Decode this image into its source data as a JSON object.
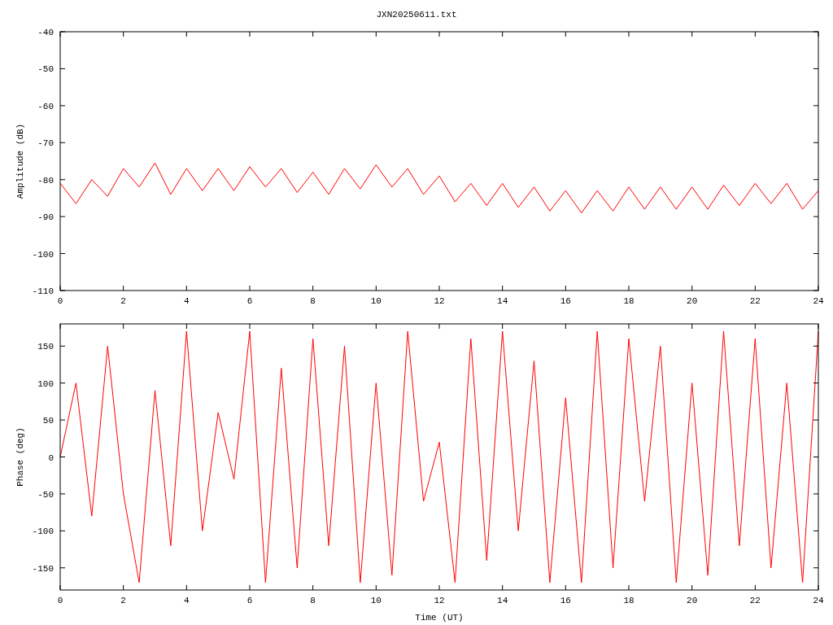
{
  "title": "JXN20250611.txt",
  "amplitude_panel": {
    "chart_data": {
      "type": "line",
      "ylabel": "Amplitude (dB)",
      "xlim": [
        0,
        24
      ],
      "ylim": [
        -110,
        -40
      ],
      "xticks": [
        0,
        2,
        4,
        6,
        8,
        10,
        12,
        14,
        16,
        18,
        20,
        22,
        24
      ],
      "yticks": [
        -40,
        -50,
        -60,
        -70,
        -80,
        -90,
        -100,
        -110
      ],
      "x": [
        0,
        0.5,
        1,
        1.5,
        2,
        2.5,
        3,
        3.5,
        4,
        4.5,
        5,
        5.5,
        6,
        6.5,
        7,
        7.5,
        8,
        8.5,
        9,
        9.5,
        10,
        10.5,
        11,
        11.5,
        12,
        12.5,
        13,
        13.5,
        14,
        14.5,
        15,
        15.5,
        16,
        16.5,
        17,
        17.5,
        18,
        18.5,
        19,
        19.5,
        20,
        20.5,
        21,
        21.5,
        22,
        22.5,
        23,
        23.5,
        24
      ],
      "series": [
        {
          "color": "#ff0000",
          "values": [
            -81,
            -86.5,
            -80,
            -84.5,
            -77,
            -82,
            -75.5,
            -84,
            -77,
            -83,
            -77,
            -83,
            -76.5,
            -82,
            -77,
            -83.5,
            -78,
            -84,
            -77,
            -82.5,
            -76,
            -82,
            -77,
            -84,
            -79,
            -86,
            -81,
            -87,
            -81,
            -87.5,
            -82,
            -88.5,
            -83,
            -89,
            -83,
            -88.5,
            -82,
            -88,
            -82,
            -88,
            -82,
            -88,
            -81.5,
            -87,
            -81,
            -86.5,
            -81,
            -88,
            -83
          ]
        }
      ]
    }
  },
  "phase_panel": {
    "chart_data": {
      "type": "line",
      "xlabel": "Time (UT)",
      "ylabel": "Phase (deg)",
      "xlim": [
        0,
        24
      ],
      "ylim": [
        -180,
        180
      ],
      "xticks": [
        0,
        2,
        4,
        6,
        8,
        10,
        12,
        14,
        16,
        18,
        20,
        22,
        24
      ],
      "yticks": [
        -150,
        -100,
        -50,
        0,
        50,
        100,
        150
      ],
      "x": [
        0,
        0.5,
        1,
        1.5,
        2,
        2.5,
        3,
        3.5,
        4,
        4.5,
        5,
        5.5,
        6,
        6.5,
        7,
        7.5,
        8,
        8.5,
        9,
        9.5,
        10,
        10.5,
        11,
        11.5,
        12,
        12.5,
        13,
        13.5,
        14,
        14.5,
        15,
        15.5,
        16,
        16.5,
        17,
        17.5,
        18,
        18.5,
        19,
        19.5,
        20,
        20.5,
        21,
        21.5,
        22,
        22.5,
        23,
        23.5,
        24
      ],
      "series": [
        {
          "color": "#ff0000",
          "values": [
            0,
            100,
            -80,
            150,
            -50,
            -170,
            90,
            -120,
            170,
            -100,
            60,
            -30,
            170,
            -170,
            120,
            -150,
            160,
            -120,
            150,
            -170,
            100,
            -160,
            170,
            -60,
            20,
            -170,
            160,
            -140,
            170,
            -100,
            130,
            -170,
            80,
            -170,
            170,
            -150,
            160,
            -60,
            150,
            -170,
            100,
            -160,
            170,
            -120,
            160,
            -150,
            100,
            -170,
            170
          ]
        }
      ]
    }
  }
}
